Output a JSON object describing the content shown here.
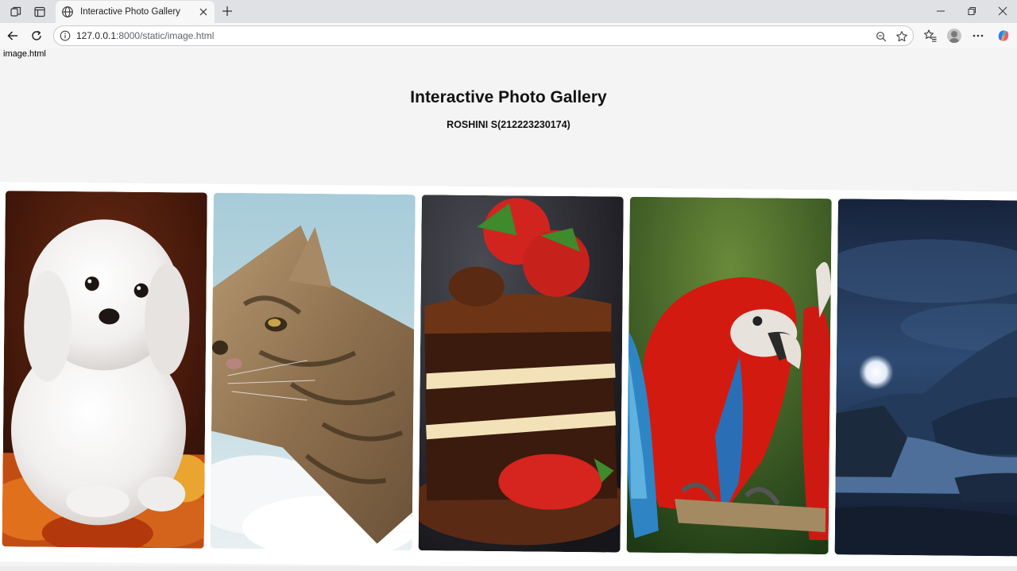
{
  "browser": {
    "tab_title": "Interactive Photo Gallery",
    "url_host": "127.0.0.1",
    "url_path": ":8000/static/image.html"
  },
  "page": {
    "file_label": "image.html",
    "title": "Interactive Photo Gallery",
    "subtitle": "ROSHINI S(212223230174)"
  },
  "gallery": {
    "images": [
      {
        "subject": "white-puppy-photo"
      },
      {
        "subject": "tabby-cat-photo"
      },
      {
        "subject": "chocolate-strawberry-cake-photo"
      },
      {
        "subject": "red-macaw-parrots-photo"
      },
      {
        "subject": "moonlit-night-landscape-photo"
      }
    ]
  },
  "colors": {
    "tab_bg": "#dfe1e5",
    "toolbar_bg": "#f7f7f7",
    "page_bg": "#f4f4f4"
  }
}
